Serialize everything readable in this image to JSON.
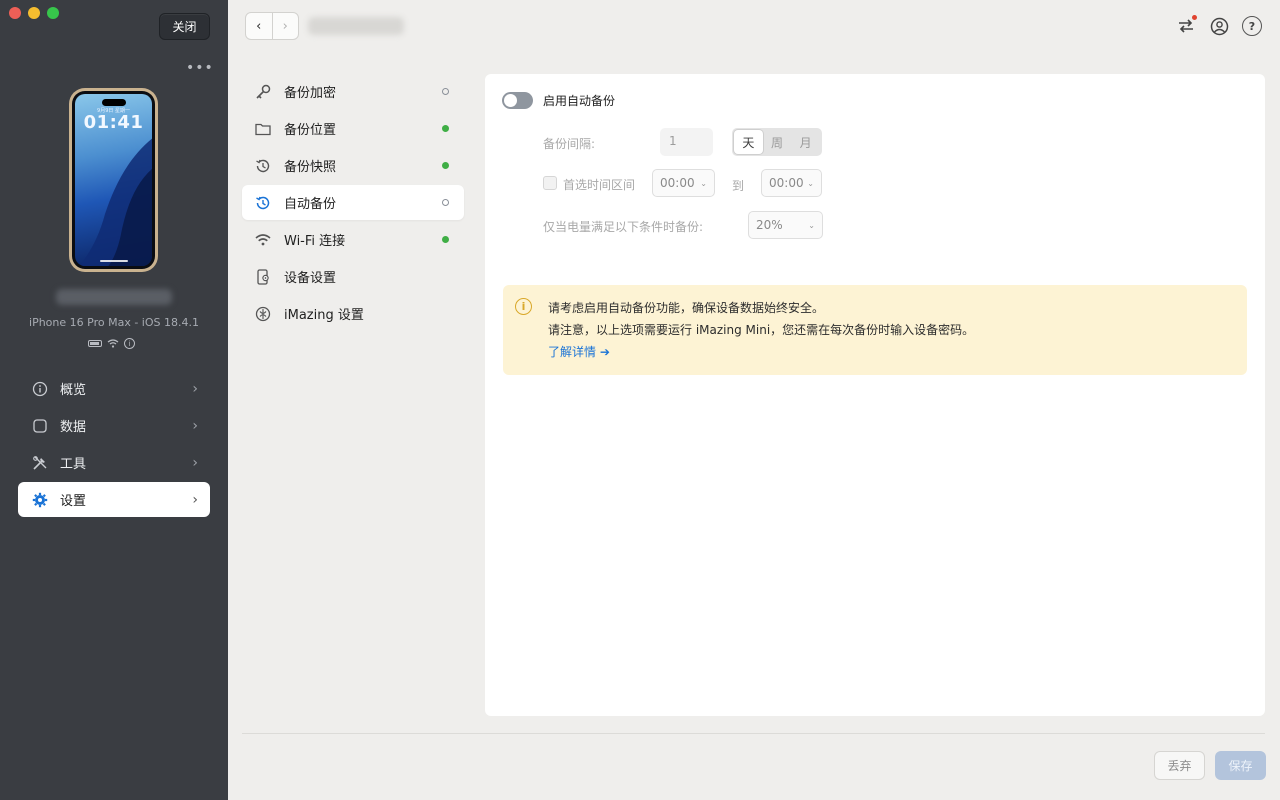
{
  "window": {
    "close_label": "关闭",
    "more_label": "•••"
  },
  "device": {
    "lock_date": "9月9日 星期一",
    "lock_time": "01:41",
    "model": "iPhone 16 Pro Max - iOS 18.4.1"
  },
  "sidebar": {
    "items": [
      {
        "label": "概览",
        "icon": "info-icon"
      },
      {
        "label": "数据",
        "icon": "square-icon"
      },
      {
        "label": "工具",
        "icon": "tools-icon"
      },
      {
        "label": "设置",
        "icon": "gear-icon",
        "active": true
      }
    ]
  },
  "settings": {
    "items": [
      {
        "label": "备份加密",
        "icon": "key-icon",
        "status": "off"
      },
      {
        "label": "备份位置",
        "icon": "folder-icon",
        "status": "on"
      },
      {
        "label": "备份快照",
        "icon": "history-icon",
        "status": "on"
      },
      {
        "label": "自动备份",
        "icon": "clock-icon",
        "status": "off",
        "active": true
      },
      {
        "label": "Wi-Fi 连接",
        "icon": "wifi-icon",
        "status": "on"
      },
      {
        "label": "设备设置",
        "icon": "device-settings-icon"
      },
      {
        "label": "iMazing 设置",
        "icon": "imazing-icon"
      }
    ]
  },
  "auto_backup": {
    "toggle_label": "启用自动备份",
    "toggle_on": false,
    "interval_label": "备份间隔:",
    "interval_value": "1",
    "units": [
      "天",
      "周",
      "月"
    ],
    "selected_unit": "天",
    "preferred_time_label": "首选时间区间",
    "time_from": "00:00",
    "to_label": "到",
    "time_to": "00:00",
    "battery_label": "仅当电量满足以下条件时备份:",
    "battery_value": "20%"
  },
  "notice": {
    "line1": "请考虑启用自动备份功能，确保设备数据始终安全。",
    "line2": "请注意，以上选项需要运行 iMazing Mini，您还需在每次备份时输入设备密码。",
    "link": "了解详情 ➔"
  },
  "footer": {
    "discard_label": "丢弃",
    "save_label": "保存"
  },
  "colors": {
    "sidebar_bg": "#3a3d42",
    "accent": "#1a73d6",
    "status_on": "#3fae45",
    "notice_bg": "#fdf3d4"
  }
}
